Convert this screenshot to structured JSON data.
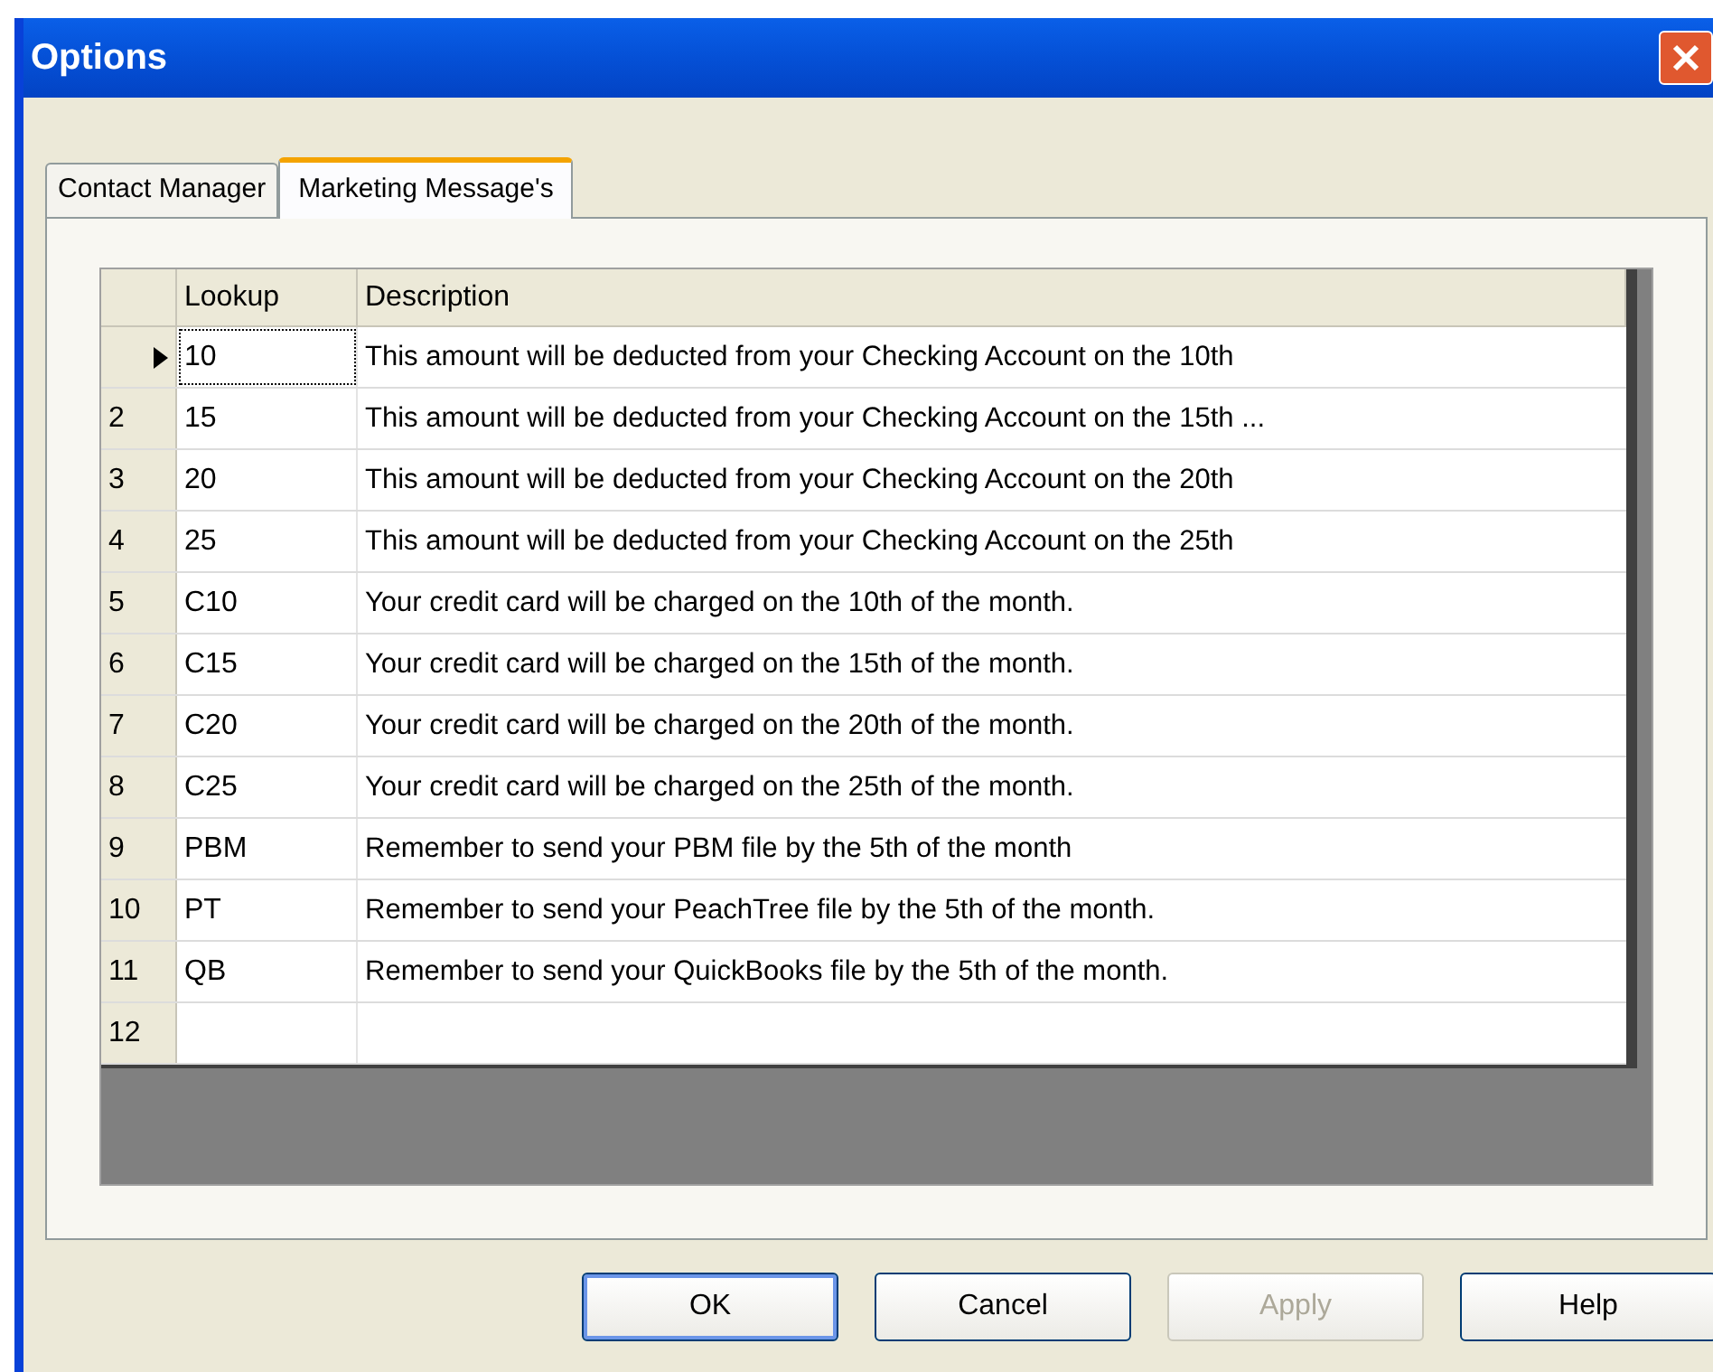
{
  "window": {
    "title": "Options"
  },
  "tabs": [
    {
      "label": "Contact Manager",
      "selected": false
    },
    {
      "label": "Marketing Message's",
      "selected": true
    }
  ],
  "table": {
    "columns": [
      "Lookup",
      "Description"
    ],
    "rows": [
      {
        "current": true,
        "lookup": "10",
        "focused": true,
        "description": "This amount will be deducted from your Checking Account on the 10th"
      },
      {
        "current": false,
        "number": "2",
        "lookup": "15",
        "focused": false,
        "description": "This amount will be deducted from your Checking Account on the 15th ..."
      },
      {
        "current": false,
        "number": "3",
        "lookup": "20",
        "focused": false,
        "description": "This amount will be deducted from your Checking Account on the 20th"
      },
      {
        "current": false,
        "number": "4",
        "lookup": "25",
        "focused": false,
        "description": "This amount will be deducted from your Checking Account on the 25th"
      },
      {
        "current": false,
        "number": "5",
        "lookup": "C10",
        "focused": false,
        "description": "Your credit card will be charged on the 10th of the month."
      },
      {
        "current": false,
        "number": "6",
        "lookup": "C15",
        "focused": false,
        "description": "Your credit card will be charged on the 15th of the month."
      },
      {
        "current": false,
        "number": "7",
        "lookup": "C20",
        "focused": false,
        "description": "Your credit card will be charged on the 20th of the month."
      },
      {
        "current": false,
        "number": "8",
        "lookup": "C25",
        "focused": false,
        "description": "Your credit card will be charged on the 25th of the month."
      },
      {
        "current": false,
        "number": "9",
        "lookup": "PBM",
        "focused": false,
        "description": "Remember to send your PBM file by the 5th of the month"
      },
      {
        "current": false,
        "number": "10",
        "lookup": "PT",
        "focused": false,
        "description": "Remember to send your PeachTree file by the 5th of the month."
      },
      {
        "current": false,
        "number": "11",
        "lookup": "QB",
        "focused": false,
        "description": "Remember to send your QuickBooks file by the 5th of the month."
      },
      {
        "current": false,
        "number": "12",
        "focused": false
      }
    ]
  },
  "buttons": [
    {
      "label": "OK",
      "disabled": false,
      "default": true
    },
    {
      "label": "Cancel",
      "disabled": false,
      "default": false
    },
    {
      "label": "Apply",
      "disabled": true,
      "default": false
    },
    {
      "label": "Help",
      "disabled": false,
      "default": false
    }
  ]
}
